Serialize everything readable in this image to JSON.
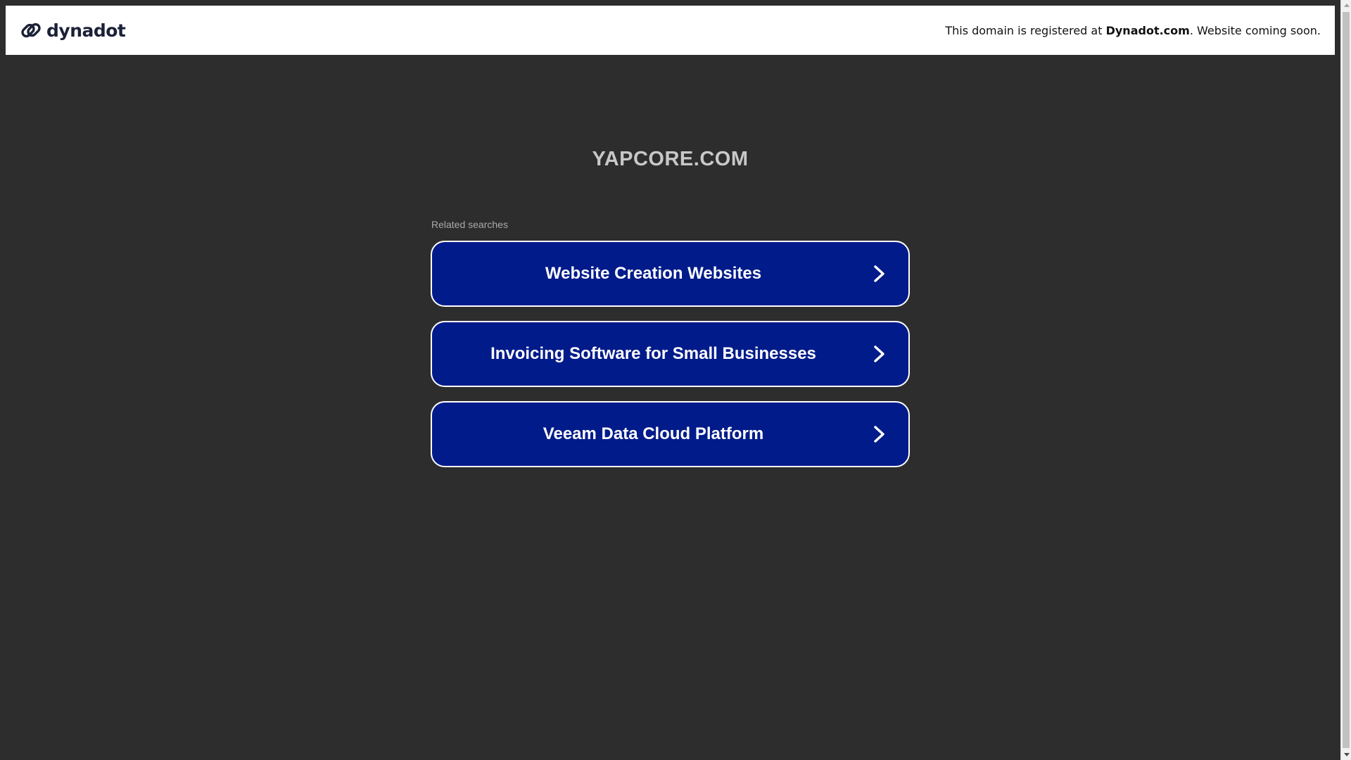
{
  "banner": {
    "logo_text": "dynadot",
    "message_prefix": "This domain is registered at ",
    "message_brand": "Dynadot.com",
    "message_suffix": ". Website coming soon."
  },
  "main": {
    "domain": "YAPCORE.COM",
    "related_label": "Related searches",
    "searches": [
      {
        "label": "Website Creation Websites",
        "icon": "chevron-right-icon"
      },
      {
        "label": "Invoicing Software for Small Businesses",
        "icon": "chevron-right-icon"
      },
      {
        "label": "Veeam Data Cloud Platform",
        "icon": "chevron-right-icon"
      }
    ]
  },
  "colors": {
    "background": "#2d2d2d",
    "button_bg": "#011b8a",
    "button_border": "#ffffff",
    "title": "#c8c8c8",
    "logo": "#1b2137"
  },
  "icons": {
    "logo": "dynadot-link-icon",
    "search_chevron": "chevron-right-icon"
  }
}
